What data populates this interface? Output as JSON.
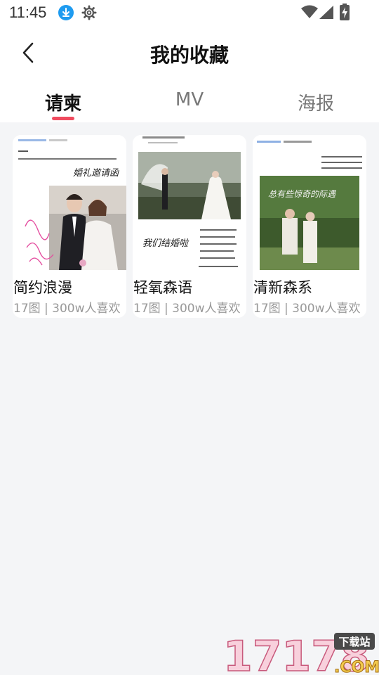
{
  "status_bar": {
    "time": "11:45"
  },
  "header": {
    "title": "我的收藏"
  },
  "tabs": [
    {
      "label": "请柬",
      "active": true
    },
    {
      "label": "MV",
      "active": false
    },
    {
      "label": "海报",
      "active": false
    }
  ],
  "cards": [
    {
      "title": "简约浪漫",
      "meta": "17图 | 300w人喜欢",
      "script_text": "婚礼邀请函"
    },
    {
      "title": "轻氧森语",
      "meta": "17图 | 300w人喜欢",
      "script_text": "我们结婚啦"
    },
    {
      "title": "清新森系",
      "meta": "17图 | 300w人喜欢",
      "script_text": "总有些惊奇的际遇"
    }
  ],
  "watermark": {
    "number": "17178",
    "tag": "下载站",
    "suffix": ".COM"
  },
  "colors": {
    "accent": "#f04b5f",
    "status_blue": "#1e9bf0",
    "background": "#f4f5f7"
  }
}
